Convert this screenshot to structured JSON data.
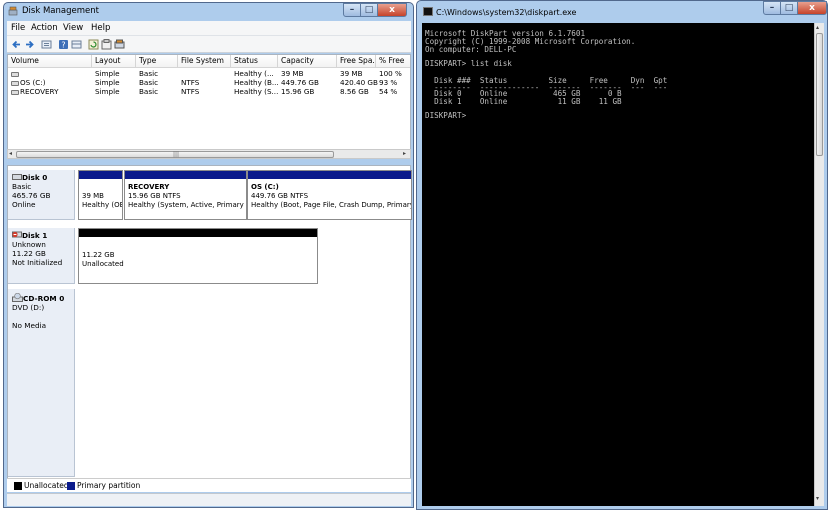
{
  "dm": {
    "title": "Disk Management",
    "menu": [
      "File",
      "Action",
      "View",
      "Help"
    ],
    "toolbar_icons": [
      "back-icon",
      "forward-icon",
      "properties-icon",
      "help-icon",
      "list-view-icon",
      "refresh-icon",
      "settings-icon",
      "disk-icon"
    ],
    "columns": [
      "Volume",
      "Layout",
      "Type",
      "File System",
      "Status",
      "Capacity",
      "Free Spa...",
      "% Free"
    ],
    "rows": [
      [
        "",
        "Simple",
        "Basic",
        "",
        "Healthy (...",
        "39 MB",
        "39 MB",
        "100 %"
      ],
      [
        "OS (C:)",
        "Simple",
        "Basic",
        "NTFS",
        "Healthy (B...",
        "449.76 GB",
        "420.40 GB",
        "93 %"
      ],
      [
        "RECOVERY",
        "Simple",
        "Basic",
        "NTFS",
        "Healthy (S...",
        "15.96 GB",
        "8.56 GB",
        "54 %"
      ]
    ],
    "disks": [
      {
        "name": "Disk 0",
        "kind": "Basic",
        "size": "465.76 GB",
        "state": "Online",
        "partitions": [
          {
            "name": "",
            "size": "39 MB",
            "status": "Healthy (OE"
          },
          {
            "name": "RECOVERY",
            "size": "15.96 GB NTFS",
            "status": "Healthy (System, Active, Primary Pa"
          },
          {
            "name": "OS  (C:)",
            "size": "449.76 GB NTFS",
            "status": "Healthy (Boot, Page File, Crash Dump, Primary Pa"
          }
        ]
      },
      {
        "name": "Disk 1",
        "kind": "Unknown",
        "size": "11.22 GB",
        "state": "Not Initialized",
        "partitions": [
          {
            "name": "",
            "size": "11.22 GB",
            "status": "Unallocated"
          }
        ]
      },
      {
        "name": "CD-ROM 0",
        "kind": "DVD (D:)",
        "size": "",
        "state": "No Media",
        "partitions": []
      }
    ],
    "legend": [
      "Unallocated",
      "Primary partition"
    ],
    "colors": {
      "primary": "#0a1a8c",
      "unallocated": "#000000"
    }
  },
  "cmd": {
    "title": "C:\\Windows\\system32\\diskpart.exe",
    "lines": [
      "Microsoft DiskPart version 6.1.7601",
      "Copyright (C) 1999-2008 Microsoft Corporation.",
      "On computer: DELL-PC",
      "",
      "DISKPART> list disk",
      "",
      "  Disk ###  Status         Size     Free     Dyn  Gpt",
      "  --------  -------------  -------  -------  ---  ---",
      "  Disk 0    Online          465 GB      0 B",
      "  Disk 1    Online           11 GB    11 GB",
      "",
      "DISKPART> "
    ]
  }
}
